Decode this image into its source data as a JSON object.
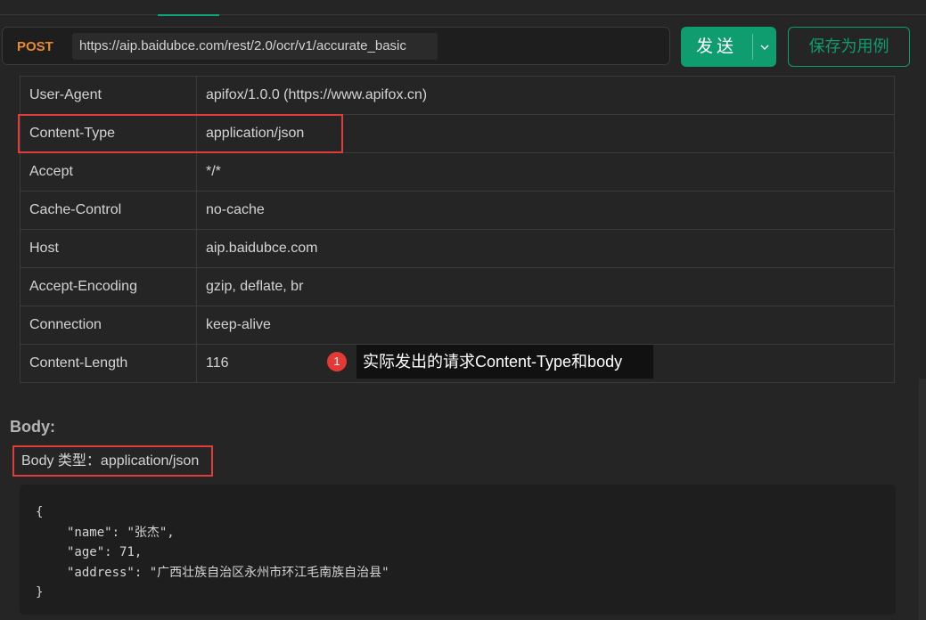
{
  "request": {
    "method": "POST",
    "url": "https://aip.baidubce.com/rest/2.0/ocr/v1/accurate_basic",
    "send_label": "发送",
    "save_label": "保存为用例"
  },
  "headers": [
    {
      "key": "User-Agent",
      "value": "apifox/1.0.0 (https://www.apifox.cn)"
    },
    {
      "key": "Content-Type",
      "value": "application/json"
    },
    {
      "key": "Accept",
      "value": "*/*"
    },
    {
      "key": "Cache-Control",
      "value": "no-cache"
    },
    {
      "key": "Host",
      "value": "aip.baidubce.com"
    },
    {
      "key": "Accept-Encoding",
      "value": "gzip, deflate, br"
    },
    {
      "key": "Connection",
      "value": "keep-alive"
    },
    {
      "key": "Content-Length",
      "value": "116"
    }
  ],
  "annotation": {
    "number": "1",
    "text": "实际发出的请求Content-Type和body"
  },
  "body": {
    "heading": "Body:",
    "type_label": "Body 类型：application/json",
    "code": {
      "open": "{",
      "close": "}",
      "fields": [
        {
          "key": "\"name\"",
          "value": "\"张杰\","
        },
        {
          "key": "\"age\"",
          "value": "71,"
        },
        {
          "key": "\"address\"",
          "value": "\"广西壮族自治区永州市环江毛南族自治县\""
        }
      ]
    }
  },
  "colors": {
    "accent": "#0f9d70",
    "method": "#e88a2f",
    "highlight": "#e03c3c",
    "badge": "#e53935",
    "json_key": "#dcdcdc",
    "json_string": "#d4d4d4"
  }
}
